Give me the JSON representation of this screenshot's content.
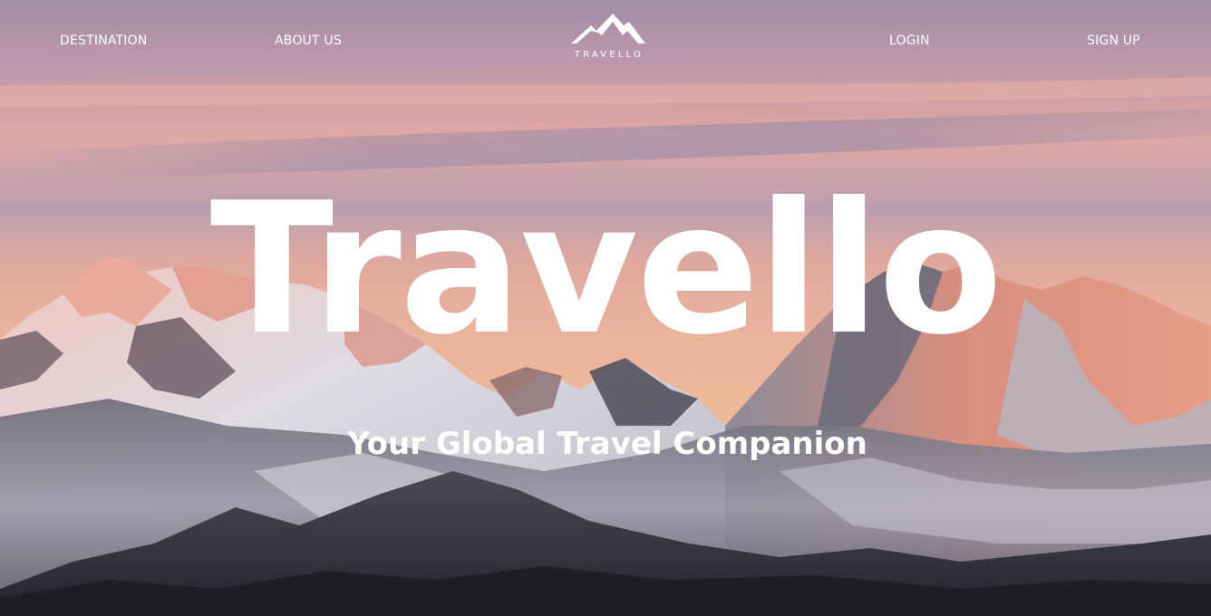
{
  "nav": {
    "destination_label": "DESTINATION",
    "about_label": "ABOUT US",
    "login_label": "LOGIN",
    "signup_label": "SIGN UP"
  },
  "logo": {
    "text": "TRAVELLO",
    "icon": "mountain-logo-icon"
  },
  "hero": {
    "title": "Travello",
    "subtitle": "Your Global Travel Companion",
    "background": "mountain-sunset-photo"
  },
  "colors": {
    "text": "#ffffff",
    "sky_top": "#a48ea9",
    "sky_mid": "#e6aaa1",
    "sky_low": "#e9b59d",
    "mountain_dark": "#2c2b33",
    "snow": "#e4e2e8",
    "alpenglow": "#e99a80"
  }
}
